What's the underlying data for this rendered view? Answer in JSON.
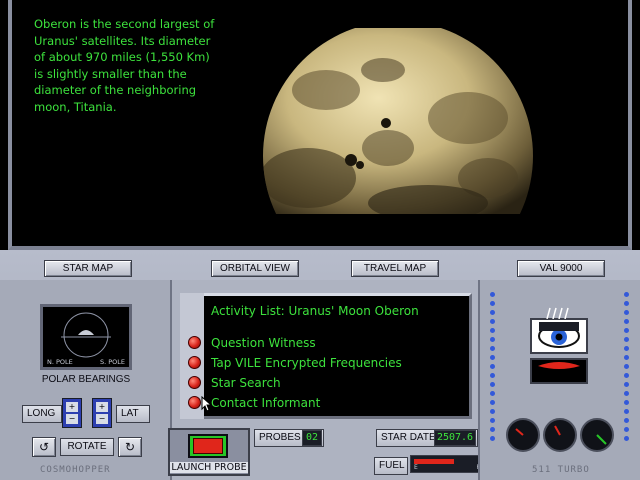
{
  "viewport": {
    "description_text": "Oberon is the second largest of\nUranus' satellites.  Its diameter\nof about 970 miles (1,550 Km)\nis slightly smaller than the\ndiameter of the neighboring\nmoon, Titania."
  },
  "nav": {
    "star_map": "STAR MAP",
    "orbital_view": "ORBITAL VIEW",
    "travel_map": "TRAVEL MAP",
    "val_9000": "VAL 9000"
  },
  "polar": {
    "n_pole": "N. POLE",
    "s_pole": "S. POLE",
    "label": "POLAR BEARINGS",
    "long": "LONG",
    "lat": "LAT",
    "rotate": "ROTATE"
  },
  "activity": {
    "title": "Activity List: Uranus' Moon Oberon",
    "items": [
      "Question Witness",
      "Tap VILE Encrypted Frequencies",
      "Star Search",
      "Contact Informant"
    ]
  },
  "status": {
    "launch_probe": "LAUNCH PROBE",
    "probes_label": "PROBES",
    "probes_value": "02",
    "star_date_label": "STAR DATE",
    "star_date_value": "2507.6",
    "fuel_label": "FUEL",
    "fuel_level": 0.6,
    "fuel_empty": "E",
    "fuel_full": "F"
  },
  "branding": {
    "left": "COSMOHOPPER",
    "right": "511 TURBO"
  },
  "colors": {
    "screen_text": "#3de23d",
    "panel": "#a5aab8",
    "button_red": "#d8241a",
    "indicator_blue": "#3359d9"
  }
}
